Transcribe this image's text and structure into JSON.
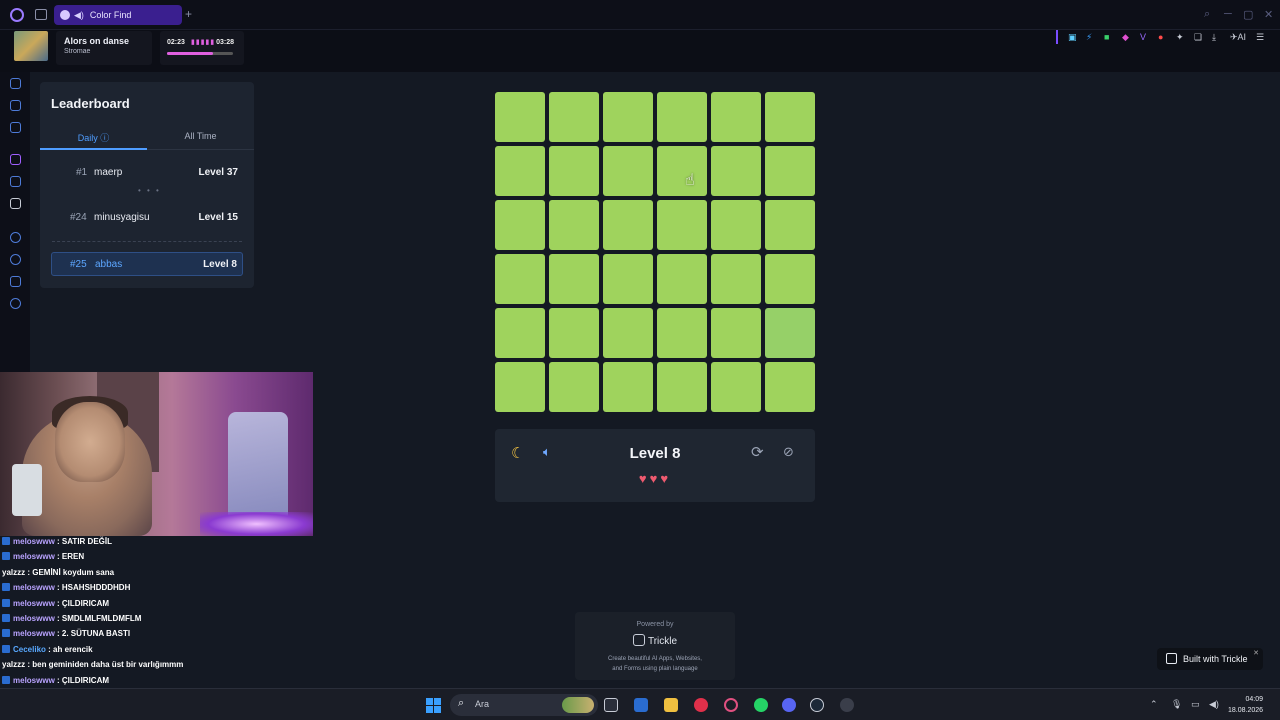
{
  "browser": {
    "tab_title": "Color Find",
    "new_tab": "+",
    "ext_ai_label": "AI"
  },
  "music": {
    "song": "Alors on danse",
    "artist": "Stromae",
    "elapsed": "02:23",
    "total": "03:28",
    "progress": 0.69
  },
  "leaderboard": {
    "title": "Leaderboard",
    "tab_daily": "Daily ⓘ",
    "tab_all": "All Time",
    "rows": [
      {
        "rank": "#1",
        "name": "maerp",
        "level": "Level 37"
      },
      {
        "rank": "#24",
        "name": "minusyagisu",
        "level": "Level 15"
      },
      {
        "rank": "#25",
        "name": "abbas",
        "level": "Level 8"
      }
    ]
  },
  "game": {
    "level": "Level 8",
    "hearts": "♥♥♥",
    "grid_rows": 6,
    "grid_cols": 6,
    "color_main": "#9fd35d",
    "color_odd": "#96d068",
    "odd_cell": {
      "row": 5,
      "col": 6
    }
  },
  "powered": {
    "line1": "Powered by",
    "brand": "Trickle",
    "line3": "Create beautiful AI Apps, Websites,",
    "line4": "and Forms using plain language"
  },
  "built_badge": "Built with Trickle",
  "chat": [
    {
      "user": "meloswww",
      "msg": " : SATIR DEĞİL",
      "badge": true,
      "style": "u1"
    },
    {
      "user": "meloswww",
      "msg": " : EREN",
      "badge": true,
      "style": "u1"
    },
    {
      "user": "yalzzz",
      "msg": " : GEMİNİ koydum sana",
      "badge": false,
      "style": "u2"
    },
    {
      "user": "meloswww",
      "msg": " : HSAHSHDDDHDH",
      "badge": true,
      "style": "u1"
    },
    {
      "user": "meloswww",
      "msg": " : ÇILDIRICAM",
      "badge": true,
      "style": "u1"
    },
    {
      "user": "meloswww",
      "msg": " : SMDLMLFMLDMFLM",
      "badge": true,
      "style": "u1"
    },
    {
      "user": "meloswww",
      "msg": " : 2. SÜTUNA BASTI",
      "badge": true,
      "style": "u1"
    },
    {
      "user": "Ceceliko",
      "msg": " : ah erencik",
      "badge": true,
      "style": "u3"
    },
    {
      "user": "yalzzz",
      "msg": " : ben geminiden daha üst bir varlığımmm",
      "badge": false,
      "style": "u2"
    },
    {
      "user": "meloswww",
      "msg": " : ÇILDIRICAM",
      "badge": true,
      "style": "u1"
    }
  ],
  "taskbar": {
    "search_text": "Ara",
    "time": "04:09",
    "date": "18.08.2026"
  }
}
